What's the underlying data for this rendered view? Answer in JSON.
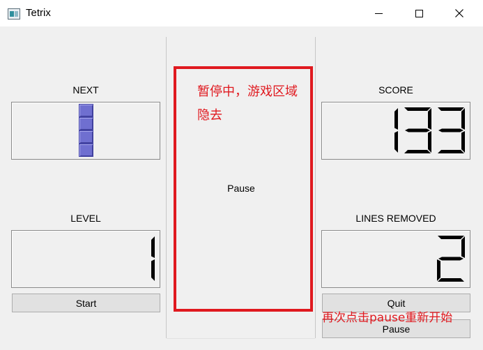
{
  "window": {
    "title": "Tetrix",
    "icon": "tetrix-app-icon",
    "controls": [
      "minimize-icon",
      "maximize-icon",
      "close-icon"
    ]
  },
  "labels": {
    "next": "NEXT",
    "level": "LEVEL",
    "score": "SCORE",
    "lines_removed": "LINES REMOVED"
  },
  "board": {
    "pause_message": "Pause"
  },
  "displays": {
    "score": "133",
    "level": "1",
    "lines_removed": "2"
  },
  "next_piece": {
    "shape": "I",
    "orientation": "vertical",
    "blocks": 4,
    "color": "#6f6fd0"
  },
  "buttons": {
    "start": "Start",
    "quit": "Quit",
    "pause": "Pause"
  },
  "annotations": {
    "board_note_line1": "暂停中，游戏区域",
    "board_note_line2": "隐去",
    "pause_note": "再次点击pause重新开始",
    "color": "#e0191f"
  },
  "colors": {
    "background": "#f0f0f0",
    "lcd_digits": "#000000",
    "accent": "#e0191f"
  }
}
